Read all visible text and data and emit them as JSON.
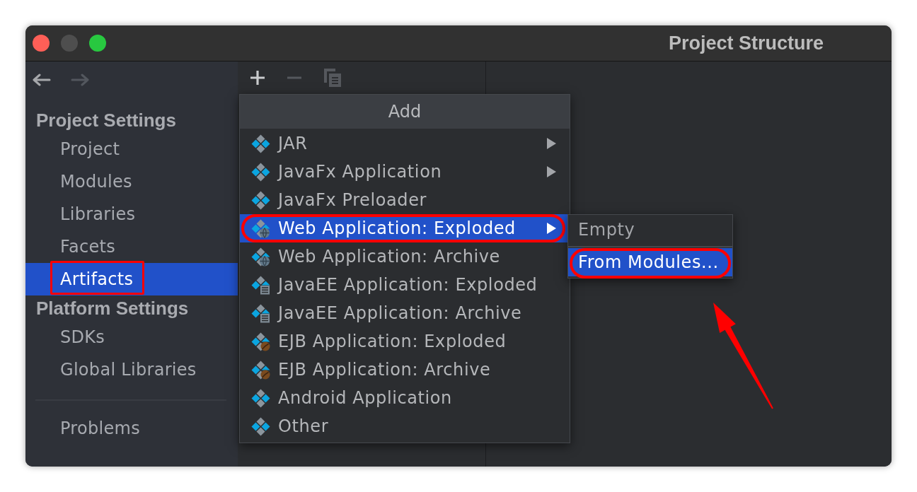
{
  "window": {
    "title": "Project Structure",
    "controls": [
      {
        "kind": "close",
        "disabled": false
      },
      {
        "kind": "minimize",
        "disabled": true
      },
      {
        "kind": "zoom",
        "disabled": false
      }
    ]
  },
  "navigation": [
    {
      "kind": "back",
      "disabled": false
    },
    {
      "kind": "forward",
      "disabled": true
    }
  ],
  "sidebar": {
    "sections": [
      {
        "title": "Project Settings",
        "items": [
          {
            "label": "Project",
            "selected": false,
            "marked": false
          },
          {
            "label": "Modules",
            "selected": false,
            "marked": false
          },
          {
            "label": "Libraries",
            "selected": false,
            "marked": false
          },
          {
            "label": "Facets",
            "selected": false,
            "marked": false
          },
          {
            "label": "Artifacts",
            "selected": true,
            "marked": true
          }
        ]
      },
      {
        "title": "Platform Settings",
        "items": [
          {
            "label": "SDKs",
            "selected": false,
            "marked": false
          },
          {
            "label": "Global Libraries",
            "selected": false,
            "marked": false
          }
        ]
      }
    ],
    "footer_items": [
      {
        "label": "Problems",
        "selected": false,
        "marked": false
      }
    ]
  },
  "toolbar": [
    {
      "kind": "add",
      "disabled": false
    },
    {
      "kind": "remove",
      "disabled": true
    },
    {
      "kind": "copy",
      "disabled": true
    }
  ],
  "add_menu": {
    "title": "Add",
    "items": [
      {
        "kind": "artifact",
        "label": "JAR",
        "submenu": true,
        "selected": false,
        "marked": false
      },
      {
        "kind": "artifact",
        "label": "JavaFx Application",
        "submenu": true,
        "selected": false,
        "marked": false
      },
      {
        "kind": "artifact",
        "label": "JavaFx Preloader",
        "submenu": false,
        "selected": false,
        "marked": false
      },
      {
        "kind": "web",
        "label": "Web Application: Exploded",
        "submenu": true,
        "selected": true,
        "marked": true
      },
      {
        "kind": "web",
        "label": "Web Application: Archive",
        "submenu": false,
        "selected": false,
        "marked": false
      },
      {
        "kind": "javaee",
        "label": "JavaEE Application: Exploded",
        "submenu": false,
        "selected": false,
        "marked": false
      },
      {
        "kind": "javaee",
        "label": "JavaEE Application: Archive",
        "submenu": false,
        "selected": false,
        "marked": false
      },
      {
        "kind": "ejb",
        "label": "EJB Application: Exploded",
        "submenu": false,
        "selected": false,
        "marked": false
      },
      {
        "kind": "ejb",
        "label": "EJB Application: Archive",
        "submenu": false,
        "selected": false,
        "marked": false
      },
      {
        "kind": "artifact",
        "label": "Android Application",
        "submenu": false,
        "selected": false,
        "marked": false
      },
      {
        "kind": "artifact",
        "label": "Other",
        "submenu": false,
        "selected": false,
        "marked": false
      }
    ]
  },
  "submenu": {
    "items": [
      {
        "kind": "item",
        "label": "Empty",
        "selected": false,
        "marked": false
      },
      {
        "kind": "separator"
      },
      {
        "kind": "item",
        "label": "From Modules...",
        "selected": true,
        "marked": true
      }
    ]
  },
  "annotations": [
    {
      "kind": "arrow"
    }
  ]
}
